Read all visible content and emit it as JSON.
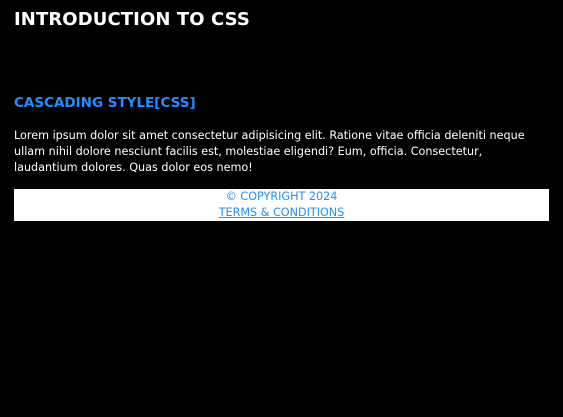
{
  "header": {
    "title": "INTRODUCTION TO CSS"
  },
  "section": {
    "heading": "CASCADING STYLE[CSS]",
    "body": "Lorem ipsum dolor sit amet consectetur adipisicing elit. Ratione vitae officia deleniti neque ullam nihil dolore nesciunt facilis est, molestiae eligendi? Eum, officia. Consectetur, laudantium dolores. Quas dolor eos nemo!"
  },
  "footer": {
    "copyright": "© COPYRIGHT 2024",
    "terms_link": "TERMS & CONDITIONS"
  },
  "colors": {
    "background": "#000000",
    "accent": "#1e90ff",
    "footer_background": "#ffffff"
  }
}
